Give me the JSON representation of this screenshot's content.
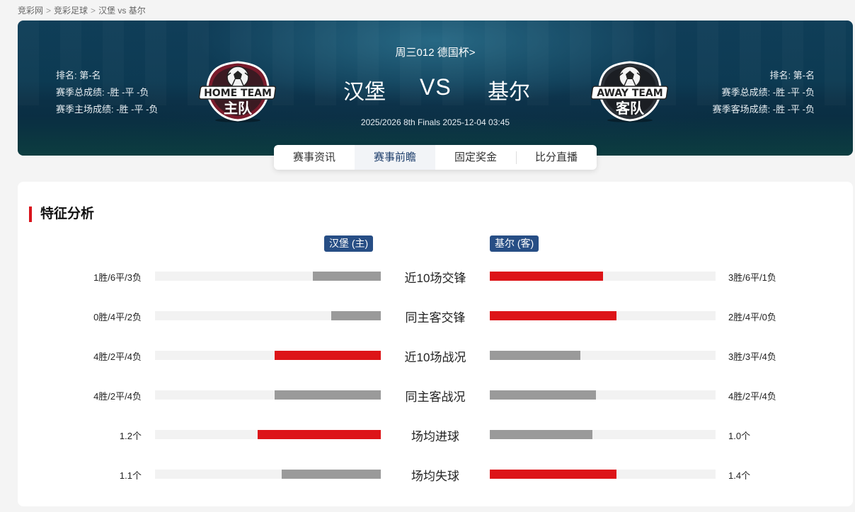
{
  "breadcrumb": {
    "items": [
      "竞彩网",
      "竞彩足球",
      "汉堡 vs 基尔"
    ],
    "separator": ">"
  },
  "match": {
    "league": "周三012 德国杯>",
    "home": {
      "name": "汉堡",
      "logo_line1": "HOME TEAM",
      "logo_line2": "主队",
      "stats": [
        "排名: 第-名",
        "赛季总成绩: -胜 -平 -负",
        "赛季主场成绩: -胜 -平 -负"
      ]
    },
    "vs": "VS",
    "away": {
      "name": "基尔",
      "logo_line1": "AWAY TEAM",
      "logo_line2": "客队",
      "stats": [
        "排名: 第-名",
        "赛季总成绩: -胜 -平 -负",
        "赛季客场成绩: -胜 -平 -负"
      ]
    },
    "time": "2025/2026 8th Finals 2025-12-04 03:45"
  },
  "tabs": [
    {
      "label": "赛事资讯",
      "active": false
    },
    {
      "label": "赛事前瞻",
      "active": true
    },
    {
      "label": "固定奖金",
      "active": false
    },
    {
      "label": "比分直播",
      "active": false
    }
  ],
  "analysis": {
    "title": "特征分析",
    "home_badge": "汉堡 (主)",
    "away_badge": "基尔 (客)",
    "colors": {
      "highlight": "#dd1418",
      "neutral": "#9a9a9a",
      "track": "#f2f2f2"
    },
    "rows": [
      {
        "label": "近10场交锋",
        "home_text": "1胜/6平/3负",
        "away_text": "3胜/6平/1负",
        "home_ratio": 0.3,
        "away_ratio": 0.5,
        "highlight": "away"
      },
      {
        "label": "同主客交锋",
        "home_text": "0胜/4平/2负",
        "away_text": "2胜/4平/0负",
        "home_ratio": 0.22,
        "away_ratio": 0.56,
        "highlight": "away"
      },
      {
        "label": "近10场战况",
        "home_text": "4胜/2平/4负",
        "away_text": "3胜/3平/4负",
        "home_ratio": 0.47,
        "away_ratio": 0.4,
        "highlight": "home"
      },
      {
        "label": "同主客战况",
        "home_text": "4胜/2平/4负",
        "away_text": "4胜/2平/4负",
        "home_ratio": 0.47,
        "away_ratio": 0.47,
        "highlight": "none"
      },
      {
        "label": "场均进球",
        "home_text": "1.2个",
        "away_text": "1.0个",
        "home_ratio": 0.545,
        "away_ratio": 0.455,
        "highlight": "home"
      },
      {
        "label": "场均失球",
        "home_text": "1.1个",
        "away_text": "1.4个",
        "home_ratio": 0.44,
        "away_ratio": 0.56,
        "highlight": "away"
      }
    ]
  }
}
